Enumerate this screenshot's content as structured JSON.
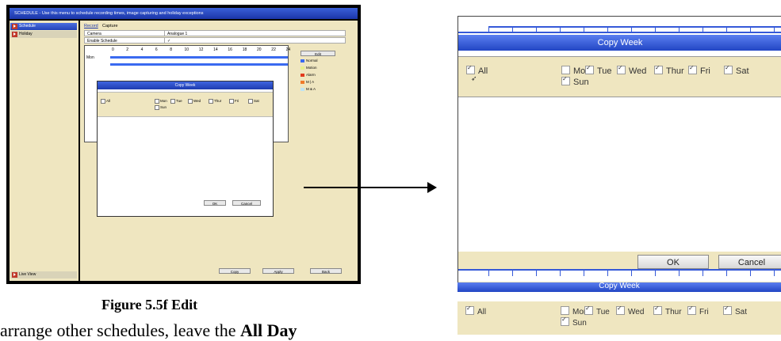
{
  "left_shot": {
    "title": "SCHEDULE - Use this menu to schedule recording times, image capturing and holiday exceptions",
    "sidebar": [
      {
        "label": "Schedule",
        "active": true
      },
      {
        "label": "Holiday",
        "active": false
      }
    ],
    "sidebar_bottom": "Live View",
    "tabs": [
      "Record",
      "Capture"
    ],
    "camera_label": "Camera",
    "camera_value": "Analogue 1",
    "enable_label": "Enable Schedule",
    "hours": [
      "0",
      "2",
      "4",
      "6",
      "8",
      "10",
      "12",
      "14",
      "16",
      "18",
      "20",
      "22",
      "24"
    ],
    "day_label": "Mon",
    "edit_button": "Edit",
    "legend": [
      {
        "label": "Normal",
        "color": "#3a6af0"
      },
      {
        "label": "Motion",
        "color": "#e8f08a"
      },
      {
        "label": "Alarm",
        "color": "#e23a1e"
      },
      {
        "label": "M | A",
        "color": "#f07a2a"
      },
      {
        "label": "M & A",
        "color": "#bfe4f4"
      }
    ],
    "bottom_buttons": [
      "Copy",
      "Apply",
      "Back"
    ],
    "dialog": {
      "title": "Copy Week",
      "all_label": "All",
      "days": [
        "Mon",
        "Tue",
        "Wed",
        "Thur",
        "Fri",
        "Sat",
        "Sun"
      ],
      "ok": "OK",
      "cancel": "Cancel"
    }
  },
  "caption": "Figure 5.5f   Edit",
  "body_text": {
    "before": "arrange other schedules, leave the ",
    "bold": "All Day"
  },
  "zoom_dialog": {
    "title": "Copy Week",
    "all_label": "All",
    "days": [
      {
        "label": "Mon",
        "checked": false
      },
      {
        "label": "Tue",
        "checked": true
      },
      {
        "label": "Wed",
        "checked": true
      },
      {
        "label": "Thur",
        "checked": true
      },
      {
        "label": "Fri",
        "checked": true
      },
      {
        "label": "Sat",
        "checked": true
      },
      {
        "label": "Sun",
        "checked": true
      }
    ],
    "ok": "OK",
    "cancel": "Cancel"
  },
  "zoom_fragment": {
    "title": "Copy Week",
    "all_label": "All",
    "days": [
      "Mon",
      "Tue",
      "Wed",
      "Thur",
      "Fri",
      "Sat",
      "Sun"
    ]
  }
}
